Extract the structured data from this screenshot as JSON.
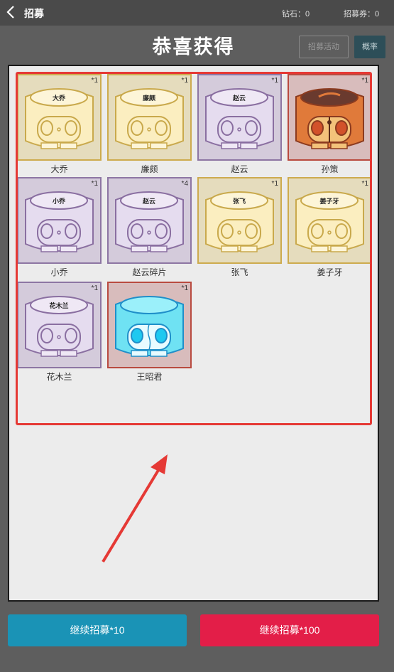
{
  "header": {
    "title": "招募",
    "diamond_label": "钻石：0",
    "ticket_label": "招募券：0"
  },
  "background": {
    "activity_button": "招募活动",
    "rate_button": "概率"
  },
  "result": {
    "heading": "恭喜获得",
    "items": [
      {
        "name": "大乔",
        "badge": "大乔",
        "qty": "*1",
        "rarity": "gold"
      },
      {
        "name": "廉颇",
        "badge": "廉颇",
        "qty": "*1",
        "rarity": "gold"
      },
      {
        "name": "赵云",
        "badge": "赵云",
        "qty": "*1",
        "rarity": "purple"
      },
      {
        "name": "孙策",
        "badge": "",
        "qty": "*1",
        "rarity": "red"
      },
      {
        "name": "小乔",
        "badge": "小乔",
        "qty": "*1",
        "rarity": "purple"
      },
      {
        "name": "赵云碎片",
        "badge": "赵云",
        "qty": "*4",
        "rarity": "purple"
      },
      {
        "name": "张飞",
        "badge": "张飞",
        "qty": "*1",
        "rarity": "gold"
      },
      {
        "name": "姜子牙",
        "badge": "姜子牙",
        "qty": "*1",
        "rarity": "gold"
      },
      {
        "name": "花木兰",
        "badge": "花木兰",
        "qty": "*1",
        "rarity": "purple"
      },
      {
        "name": "王昭君",
        "badge": "",
        "qty": "*1",
        "rarity": "red-blue"
      }
    ]
  },
  "actions": {
    "recruit_10": "继续招募*10",
    "recruit_100": "继续招募*100"
  },
  "colors": {
    "accent_blue": "#1a93b6",
    "accent_red": "#e31e48",
    "highlight_red": "#e53935"
  }
}
